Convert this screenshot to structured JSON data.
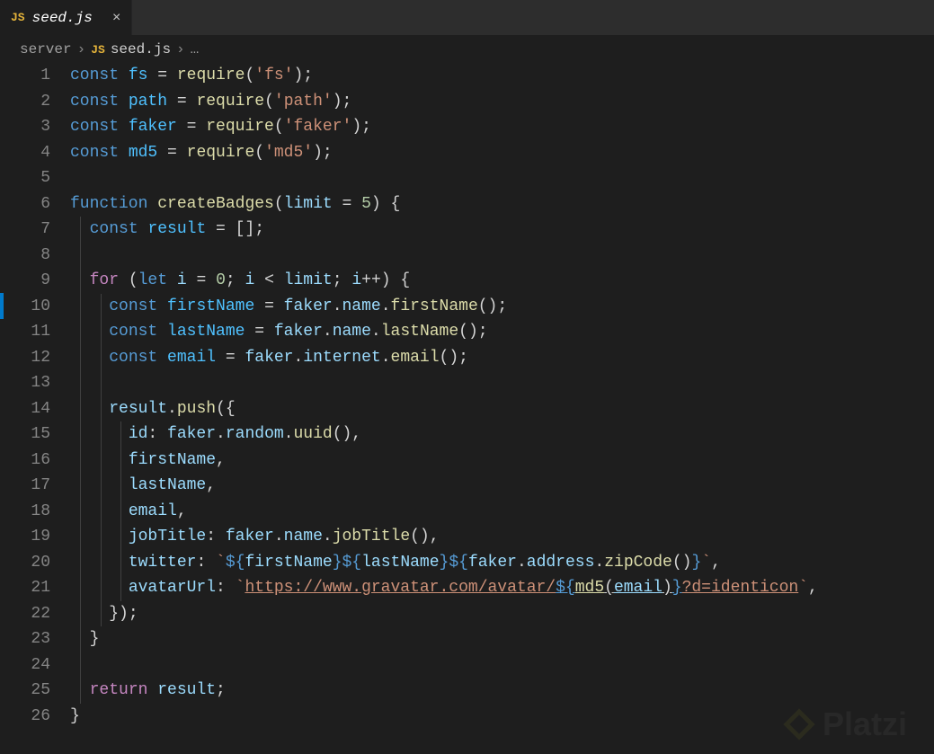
{
  "tab": {
    "icon": "JS",
    "label": "seed.js",
    "close": "×"
  },
  "breadcrumb": {
    "folder": "server",
    "sep": "›",
    "icon": "JS",
    "file": "seed.js",
    "ell": "…"
  },
  "watermark": "Platzi",
  "colors": {
    "background": "#1e1e1e",
    "keyword_blue": "#569cd6",
    "keyword_purple": "#c586c0",
    "variable": "#9cdcfe",
    "const_var": "#4fc1ff",
    "function": "#dcdcaa",
    "string": "#ce9178",
    "number": "#b5cea8"
  },
  "lines": [
    1,
    2,
    3,
    4,
    5,
    6,
    7,
    8,
    9,
    10,
    11,
    12,
    13,
    14,
    15,
    16,
    17,
    18,
    19,
    20,
    21,
    22,
    23,
    24,
    25,
    26
  ],
  "code": {
    "l1": {
      "kw": "const",
      "v": "fs",
      "eq": " = ",
      "fn": "require",
      "p1": "(",
      "s": "'fs'",
      "p2": ");"
    },
    "l2": {
      "kw": "const",
      "v": "path",
      "eq": " = ",
      "fn": "require",
      "p1": "(",
      "s": "'path'",
      "p2": ");"
    },
    "l3": {
      "kw": "const",
      "v": "faker",
      "eq": " = ",
      "fn": "require",
      "p1": "(",
      "s": "'faker'",
      "p2": ");"
    },
    "l4": {
      "kw": "const",
      "v": "md5",
      "eq": " = ",
      "fn": "require",
      "p1": "(",
      "s": "'md5'",
      "p2": ");"
    },
    "l6": {
      "kw": "function",
      "name": "createBadges",
      "p1": "(",
      "arg": "limit",
      "eq": " = ",
      "num": "5",
      "p2": ") {"
    },
    "l7": {
      "kw": "const",
      "v": "result",
      "rest": " = [];"
    },
    "l9": {
      "kw": "for",
      "p1": " (",
      "kw2": "let",
      "v": "i",
      "eq": " = ",
      "num0": "0",
      "sep": "; ",
      "v2": "i",
      "op": " < ",
      "v3": "limit",
      "sep2": "; ",
      "v4": "i",
      "inc": "++) {"
    },
    "l10": {
      "kw": "const",
      "v": "firstName",
      "eq": " = ",
      "o": "faker",
      "d": ".",
      "o2": "name",
      "d2": ".",
      "fn": "firstName",
      "end": "();"
    },
    "l11": {
      "kw": "const",
      "v": "lastName",
      "eq": " = ",
      "o": "faker",
      "d": ".",
      "o2": "name",
      "d2": ".",
      "fn": "lastName",
      "end": "();"
    },
    "l12": {
      "kw": "const",
      "v": "email",
      "eq": " = ",
      "o": "faker",
      "d": ".",
      "o2": "internet",
      "d2": ".",
      "fn": "email",
      "end": "();"
    },
    "l14": {
      "v": "result",
      "d": ".",
      "fn": "push",
      "p": "({"
    },
    "l15": {
      "k": "id",
      "c": ": ",
      "o": "faker",
      "d": ".",
      "o2": "random",
      "d2": ".",
      "fn": "uuid",
      "end": "(),"
    },
    "l16": {
      "k": "firstName",
      "c": ","
    },
    "l17": {
      "k": "lastName",
      "c": ","
    },
    "l18": {
      "k": "email",
      "c": ","
    },
    "l19": {
      "k": "jobTitle",
      "c": ": ",
      "o": "faker",
      "d": ".",
      "o2": "name",
      "d2": ".",
      "fn": "jobTitle",
      "end": "(),"
    },
    "l20": {
      "k": "twitter",
      "c": ": ",
      "bt": "`",
      "i1": "${",
      "v1": "firstName",
      "i1e": "}",
      "i2": "${",
      "v2": "lastName",
      "i2e": "}",
      "i3": "${",
      "o": "faker",
      "d": ".",
      "o2": "address",
      "d2": ".",
      "fn": "zipCode",
      "pe": "()",
      "i3e": "}",
      "bt2": "`",
      "comma": ","
    },
    "l21": {
      "k": "avatarUrl",
      "c": ": ",
      "bt": "`",
      "url": "https://www.gravatar.com/avatar/",
      "i1": "${",
      "fn": "md5",
      "p1": "(",
      "v": "email",
      "p2": ")",
      "i1e": "}",
      "url2": "?d=identicon",
      "bt2": "`",
      "comma": ","
    },
    "l22": {
      "p": "});"
    },
    "l23": {
      "p": "}"
    },
    "l25": {
      "kw": "return",
      "v": "result",
      "semi": ";"
    },
    "l26": {
      "p": "}"
    }
  }
}
